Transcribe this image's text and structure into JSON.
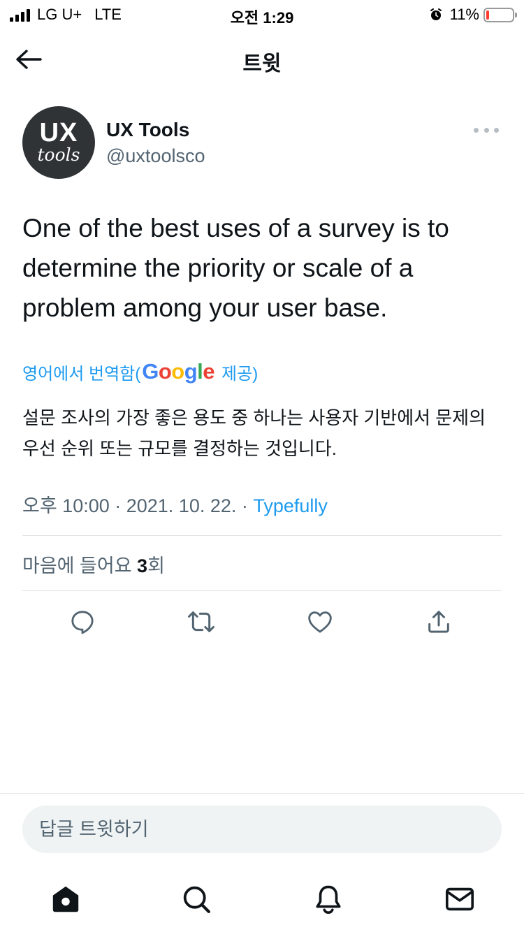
{
  "status_bar": {
    "carrier": "LG U+",
    "network": "LTE",
    "time": "오전 1:29",
    "battery_percent": "11%",
    "battery_level": 0.11,
    "battery_color": "#ff3b30"
  },
  "nav": {
    "title": "트윗",
    "back_icon": "arrow-left-icon"
  },
  "tweet": {
    "avatar": {
      "line1": "UX",
      "line2": "tools"
    },
    "author_name": "UX Tools",
    "author_handle": "@uxtoolsco",
    "more_icon": "more-horizontal-icon",
    "text": "One of the best uses of a survey is to determine the priority or scale of a problem among your user base.",
    "translation": {
      "prefix": "영어에서 번역함(",
      "provider": "Google",
      "suffix": "제공)",
      "text": "설문 조사의 가장 좋은 용도 중 하나는 사용자 기반에서 문제의 우선 순위 또는 규모를 결정하는 것입니다."
    },
    "meta": {
      "timestamp": "오후 10:00 · 2021. 10. 22. · ",
      "source": "Typefully"
    },
    "likes": {
      "prefix": "마음에 들어요 ",
      "count": "3",
      "suffix": "회"
    },
    "actions": [
      {
        "name": "reply",
        "icon": "reply-icon"
      },
      {
        "name": "retweet",
        "icon": "retweet-icon"
      },
      {
        "name": "like",
        "icon": "heart-icon"
      },
      {
        "name": "share",
        "icon": "share-icon"
      }
    ]
  },
  "reply": {
    "placeholder": "답글 트윗하기"
  },
  "tab_bar": [
    {
      "name": "home",
      "icon": "home-icon"
    },
    {
      "name": "search",
      "icon": "search-icon"
    },
    {
      "name": "notifications",
      "icon": "bell-icon"
    },
    {
      "name": "messages",
      "icon": "mail-icon"
    }
  ],
  "colors": {
    "accent": "#1d9bf0",
    "text_primary": "#0f1419",
    "text_secondary": "#536471",
    "divider": "#e1e4e6"
  }
}
